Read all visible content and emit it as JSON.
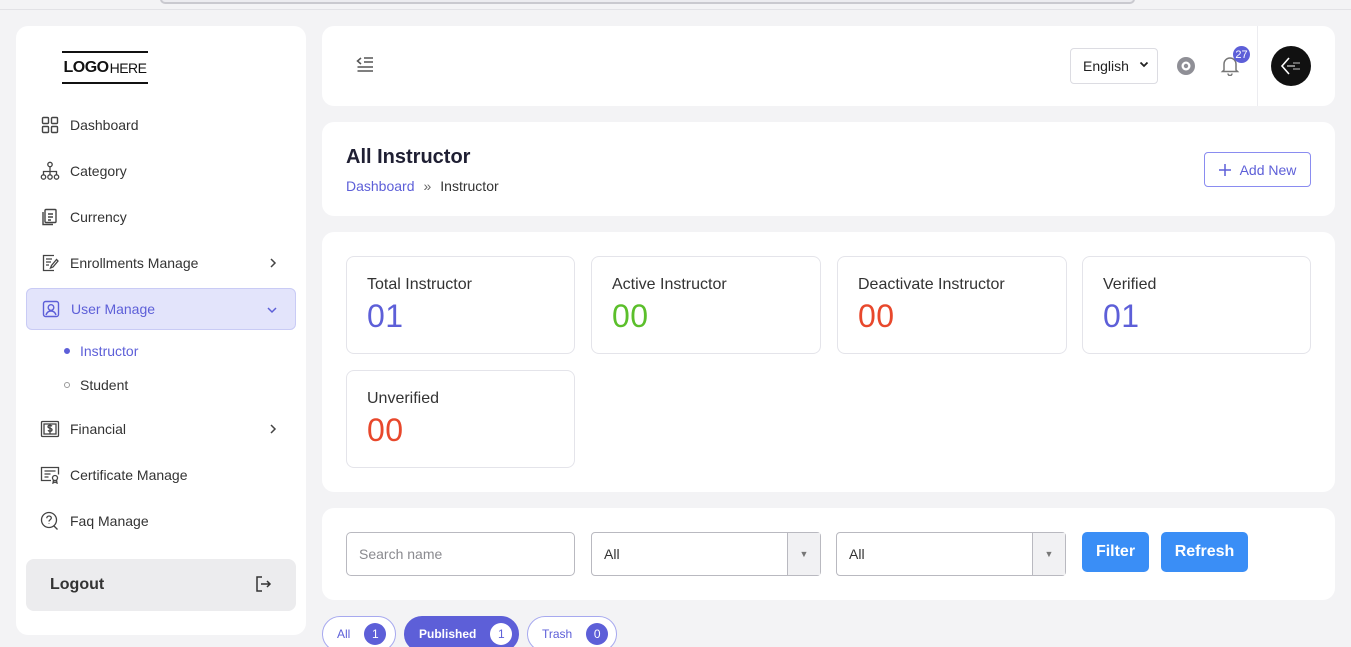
{
  "logo": {
    "bold": "LOGO",
    "light": "HERE"
  },
  "sidebar": {
    "items": [
      {
        "label": "Dashboard",
        "icon": "dashboard-icon"
      },
      {
        "label": "Category",
        "icon": "sitemap-icon"
      },
      {
        "label": "Currency",
        "icon": "currency-icon"
      },
      {
        "label": "Enrollments Manage",
        "icon": "enrollments-icon"
      },
      {
        "label": "User Manage",
        "icon": "user-icon"
      },
      {
        "label": "Financial",
        "icon": "dollar-icon"
      },
      {
        "label": "Certificate Manage",
        "icon": "certificate-icon"
      },
      {
        "label": "Faq Manage",
        "icon": "faq-icon"
      }
    ],
    "sub_items": [
      {
        "label": "Instructor"
      },
      {
        "label": "Student"
      }
    ],
    "logout": "Logout"
  },
  "header": {
    "language": "English",
    "notification_count": "27"
  },
  "page": {
    "title": "All Instructor",
    "breadcrumb": {
      "home": "Dashboard",
      "separator": "»",
      "current": "Instructor"
    },
    "add_new": "Add New"
  },
  "stats": [
    {
      "label": "Total Instructor",
      "value": "01",
      "color": "#5d5fd8"
    },
    {
      "label": "Active Instructor",
      "value": "00",
      "color": "#5bbf2b"
    },
    {
      "label": "Deactivate Instructor",
      "value": "00",
      "color": "#e8482c"
    },
    {
      "label": "Verified",
      "value": "01",
      "color": "#5d5fd8"
    },
    {
      "label": "Unverified",
      "value": "00",
      "color": "#e8482c"
    }
  ],
  "filters": {
    "search_placeholder": "Search name",
    "select1": "All",
    "select2": "All",
    "filter": "Filter",
    "refresh": "Refresh"
  },
  "tabs": [
    {
      "label": "All",
      "count": "1"
    },
    {
      "label": "Published",
      "count": "1"
    },
    {
      "label": "Trash",
      "count": "0"
    }
  ],
  "colors": {
    "accent": "#5d5fd8",
    "button": "#3a8ef6"
  }
}
